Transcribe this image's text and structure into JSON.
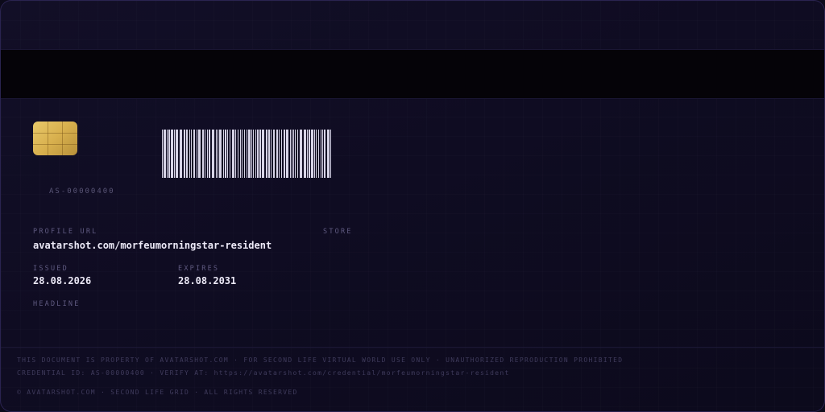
{
  "card": {
    "id": "AS-00000400",
    "profile_url_label": "PROFILE URL",
    "profile_url": "avatarshot.com/morfeumorningstar-resident",
    "store_label": "STORE",
    "issued_label": "ISSUED",
    "issued": "28.08.2026",
    "expires_label": "EXPIRES",
    "expires": "28.08.2031",
    "headline_label": "HEADLINE"
  },
  "footer": {
    "line1": "THIS DOCUMENT IS PROPERTY OF AVATARSHOT.COM · FOR SECOND LIFE VIRTUAL WORLD USE ONLY · UNAUTHORIZED REPRODUCTION PROHIBITED",
    "line2": "CREDENTIAL ID: AS-00000400 · VERIFY AT: https://avatarshot.com/credential/morfeumorningstar-resident",
    "line3": "© AVATARSHOT.COM · SECOND LIFE GRID · ALL RIGHTS RESERVED"
  },
  "colors": {
    "background": "#0f0c22",
    "stripe": "#050308",
    "chip": "#d8b04e",
    "barcode": "#d6d3e6",
    "text": "#ece9f7",
    "label": "#5f5a80"
  },
  "icons": {
    "chip": "smart-chip-icon",
    "barcode": "barcode-icon"
  }
}
